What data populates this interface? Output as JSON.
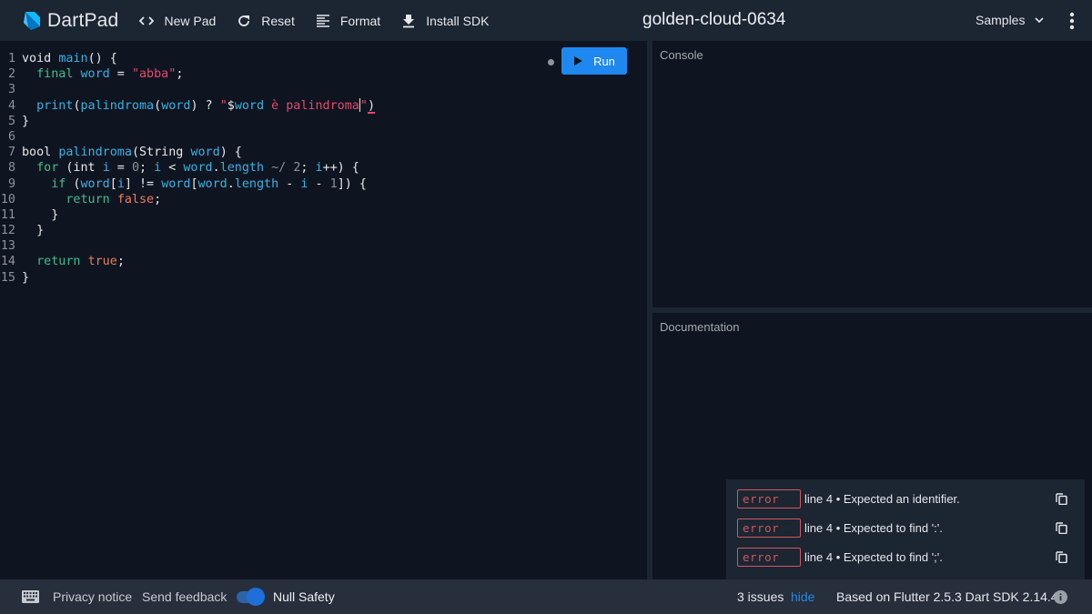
{
  "header": {
    "app_name": "DartPad",
    "buttons": [
      {
        "icon": "code-brackets-icon",
        "label": "New Pad"
      },
      {
        "icon": "refresh-icon",
        "label": "Reset"
      },
      {
        "icon": "format-align-icon",
        "label": "Format"
      },
      {
        "icon": "download-icon",
        "label": "Install SDK"
      }
    ],
    "pad_title": "golden-cloud-0634",
    "samples_label": "Samples"
  },
  "editor": {
    "run_label": "Run",
    "lines": [
      {
        "n": "1",
        "tokens": [
          [
            "ty",
            "void "
          ],
          [
            "fn",
            "main"
          ],
          [
            "pl",
            "() {"
          ]
        ]
      },
      {
        "n": "2",
        "tokens": [
          [
            "pl",
            "  "
          ],
          [
            "kw",
            "final "
          ],
          [
            "id",
            "word"
          ],
          [
            "pl",
            " = "
          ],
          [
            "str",
            "\"abba\""
          ],
          [
            "pl",
            ";"
          ]
        ]
      },
      {
        "n": "3",
        "tokens": []
      },
      {
        "n": "4",
        "tokens": [
          [
            "pl",
            "  "
          ],
          [
            "fn",
            "print"
          ],
          [
            "pl",
            "("
          ],
          [
            "fn",
            "palindroma"
          ],
          [
            "pl",
            "("
          ],
          [
            "id",
            "word"
          ],
          [
            "pl",
            ") ? "
          ],
          [
            "str",
            "\""
          ],
          [
            "pl",
            "$"
          ],
          [
            "id",
            "word"
          ],
          [
            "str",
            " è palindroma"
          ],
          [
            "cursor",
            ""
          ],
          [
            "str",
            "\""
          ],
          [
            "err",
            ")"
          ]
        ]
      },
      {
        "n": "5",
        "tokens": [
          [
            "pl",
            "}"
          ]
        ]
      },
      {
        "n": "6",
        "tokens": []
      },
      {
        "n": "7",
        "tokens": [
          [
            "ty",
            "bool "
          ],
          [
            "fn",
            "palindroma"
          ],
          [
            "pl",
            "(String "
          ],
          [
            "id",
            "word"
          ],
          [
            "pl",
            ") {"
          ]
        ]
      },
      {
        "n": "8",
        "tokens": [
          [
            "pl",
            "  "
          ],
          [
            "kw",
            "for"
          ],
          [
            "pl",
            " (int "
          ],
          [
            "id",
            "i"
          ],
          [
            "pl",
            " = "
          ],
          [
            "num",
            "0"
          ],
          [
            "pl",
            "; "
          ],
          [
            "id",
            "i"
          ],
          [
            "pl",
            " < "
          ],
          [
            "id",
            "word"
          ],
          [
            "pl",
            "."
          ],
          [
            "id",
            "length"
          ],
          [
            "pl",
            " "
          ],
          [
            "num",
            "~/"
          ],
          [
            "pl",
            " "
          ],
          [
            "num",
            "2"
          ],
          [
            "pl",
            "; "
          ],
          [
            "id",
            "i"
          ],
          [
            "pl",
            "++) {"
          ]
        ]
      },
      {
        "n": "9",
        "tokens": [
          [
            "pl",
            "    "
          ],
          [
            "kw",
            "if"
          ],
          [
            "pl",
            " ("
          ],
          [
            "id",
            "word"
          ],
          [
            "pl",
            "["
          ],
          [
            "id",
            "i"
          ],
          [
            "pl",
            "] != "
          ],
          [
            "id",
            "word"
          ],
          [
            "pl",
            "["
          ],
          [
            "id",
            "word"
          ],
          [
            "pl",
            "."
          ],
          [
            "id",
            "length"
          ],
          [
            "pl",
            " - "
          ],
          [
            "id",
            "i"
          ],
          [
            "pl",
            " - "
          ],
          [
            "num",
            "1"
          ],
          [
            "pl",
            "]) {"
          ]
        ]
      },
      {
        "n": "10",
        "tokens": [
          [
            "pl",
            "      "
          ],
          [
            "kw",
            "return "
          ],
          [
            "lit",
            "false"
          ],
          [
            "pl",
            ";"
          ]
        ]
      },
      {
        "n": "11",
        "tokens": [
          [
            "pl",
            "    }"
          ]
        ]
      },
      {
        "n": "12",
        "tokens": [
          [
            "pl",
            "  }"
          ]
        ]
      },
      {
        "n": "13",
        "tokens": []
      },
      {
        "n": "14",
        "tokens": [
          [
            "pl",
            "  "
          ],
          [
            "kw",
            "return "
          ],
          [
            "lit",
            "true"
          ],
          [
            "pl",
            ";"
          ]
        ]
      },
      {
        "n": "15",
        "tokens": [
          [
            "pl",
            "}"
          ]
        ]
      }
    ]
  },
  "console": {
    "label": "Console"
  },
  "documentation": {
    "label": "Documentation"
  },
  "issues": [
    {
      "severity": "error",
      "message": "line 4 • Expected an identifier."
    },
    {
      "severity": "error",
      "message": "line 4 • Expected to find ':'."
    },
    {
      "severity": "error",
      "message": "line 4 • Expected to find ';'."
    }
  ],
  "footer": {
    "privacy_label": "Privacy notice",
    "feedback_label": "Send feedback",
    "null_safety_label": "Null Safety",
    "null_safety_enabled": true,
    "issues_count": "3 issues",
    "hide_label": "hide",
    "version": "Based on Flutter 2.5.3 Dart SDK 2.14.4"
  },
  "colors": {
    "accent": "#1e88f0",
    "error": "#d2575d",
    "header_bg": "#1c2532",
    "editor_bg": "#0f1520"
  }
}
